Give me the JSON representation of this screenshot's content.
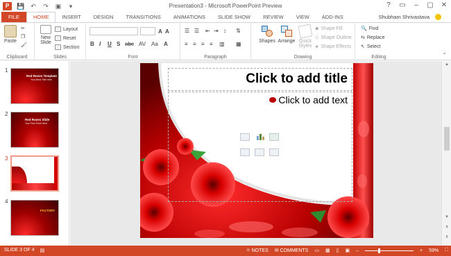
{
  "window": {
    "title": "Presentation3 - Microsoft PowerPoint Preview",
    "app_icon_letter": "P",
    "user_name": "Shubham Shrivastava",
    "controls": [
      "?",
      "▭",
      "–",
      "▢",
      "✕"
    ]
  },
  "quick_access": [
    "💾",
    "↶",
    "↷",
    "▣",
    "▾"
  ],
  "tabs": [
    {
      "label": "FILE"
    },
    {
      "label": "HOME"
    },
    {
      "label": "INSERT"
    },
    {
      "label": "DESIGN"
    },
    {
      "label": "TRANSITIONS"
    },
    {
      "label": "ANIMATIONS"
    },
    {
      "label": "SLIDE SHOW"
    },
    {
      "label": "REVIEW"
    },
    {
      "label": "VIEW"
    },
    {
      "label": "ADD-INS"
    }
  ],
  "ribbon": {
    "clipboard": {
      "label": "Clipboard",
      "paste": "Paste"
    },
    "slides": {
      "label": "Slides",
      "new_slide_1": "New",
      "new_slide_2": "Slide",
      "layout": "Layout",
      "reset": "Reset",
      "section": "Section"
    },
    "font": {
      "label": "Font",
      "bold": "B",
      "italic": "I",
      "underline": "U",
      "shadow": "S",
      "strike": "abc",
      "spacing": "AV",
      "case": "Aa",
      "color": "A"
    },
    "paragraph": {
      "label": "Paragraph"
    },
    "drawing": {
      "label": "Drawing",
      "shapes": "Shapes",
      "arrange": "Arrange",
      "quick_1": "Quick",
      "quick_2": "Styles",
      "shape_fill": "Shape Fill",
      "shape_outline": "Shape Outline",
      "shape_effects": "Shape Effects"
    },
    "editing": {
      "label": "Editing",
      "find": "Find",
      "replace": "Replace",
      "select": "Select"
    }
  },
  "thumbnails": [
    {
      "num": "1",
      "title": "Red Roses Template",
      "sub": "Your Best Title Here"
    },
    {
      "num": "2",
      "title": "Red Roses Slide",
      "sub": "Your First Point Here"
    },
    {
      "num": "3",
      "title": "",
      "sub": ""
    },
    {
      "num": "4",
      "title": "FACTORY",
      "sub": ""
    }
  ],
  "slide": {
    "title_placeholder": "Click to add title",
    "body_placeholder": "Click to add text"
  },
  "status": {
    "slide_info": "SLIDE 3 OF 4",
    "notes": "NOTES",
    "comments": "COMMENTS",
    "zoom": "59%",
    "zoom_level": 0.59
  },
  "colors": {
    "accent": "#d24726",
    "slide_red": "#b30000"
  }
}
